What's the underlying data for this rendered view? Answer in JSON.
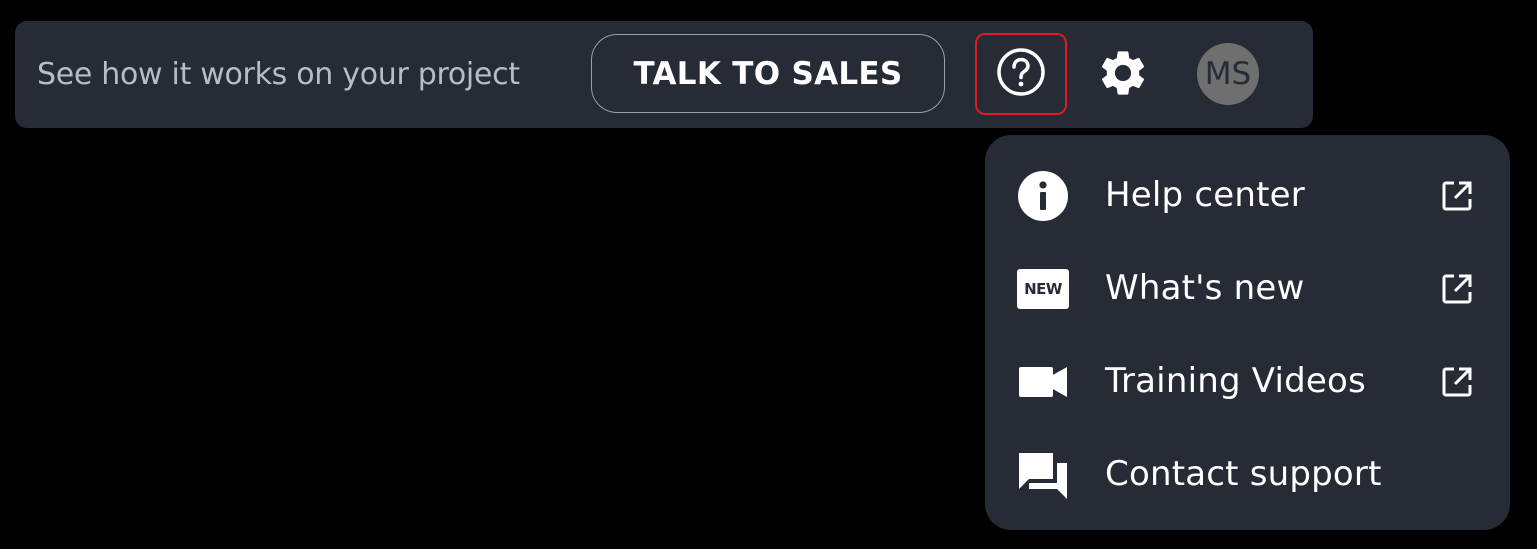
{
  "topbar": {
    "promo_text": "See how it works on your project",
    "sales_button_label": "TALK TO SALES",
    "help_icon": "help-circle-icon",
    "settings_icon": "gear-icon",
    "avatar_initials": "MS"
  },
  "help_menu": {
    "items": [
      {
        "label": "Help center",
        "icon": "info-icon",
        "external": true
      },
      {
        "label": "What's new",
        "icon": "new-badge-icon",
        "badge_text": "NEW",
        "external": true
      },
      {
        "label": "Training Videos",
        "icon": "video-camera-icon",
        "external": true
      },
      {
        "label": "Contact support",
        "icon": "chat-bubbles-icon",
        "external": false
      }
    ]
  },
  "colors": {
    "page_background": "#000000",
    "bar_background": "#262b35",
    "help_button_highlight": "#e01b24",
    "avatar_background": "#6f6f6f"
  }
}
